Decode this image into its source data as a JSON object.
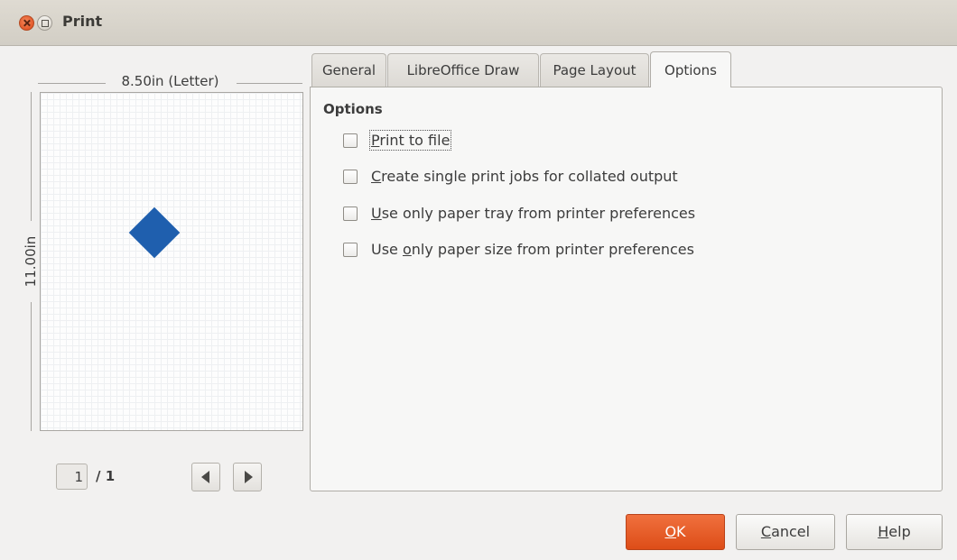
{
  "window": {
    "title": "Print"
  },
  "preview": {
    "paper_width": "8.50in (Letter)",
    "paper_height": "11.00in",
    "shape_color": "#1f5fae",
    "current_page": "1",
    "total_pages": "/ 1"
  },
  "tabs": [
    {
      "label": "General"
    },
    {
      "label": "LibreOffice Draw"
    },
    {
      "label": "Page Layout"
    },
    {
      "label": "Options",
      "active": true
    }
  ],
  "options": {
    "section_title": "Options",
    "items": [
      {
        "pre": "",
        "key": "P",
        "post": "rint to file",
        "checked": false
      },
      {
        "pre": "",
        "key": "C",
        "post": "reate single print jobs for collated output",
        "checked": false
      },
      {
        "pre": "",
        "key": "U",
        "post": "se only paper tray from printer preferences",
        "checked": false
      },
      {
        "pre": "Use ",
        "key": "o",
        "post": "nly paper size from printer preferences",
        "checked": false
      }
    ]
  },
  "buttons": {
    "ok": {
      "key": "O",
      "rest": "K"
    },
    "cancel": {
      "key": "C",
      "rest": "ancel"
    },
    "help": {
      "key": "H",
      "rest": "elp"
    }
  },
  "colors": {
    "ok_button": "#dd4d18",
    "close_button": "#e2582a"
  }
}
